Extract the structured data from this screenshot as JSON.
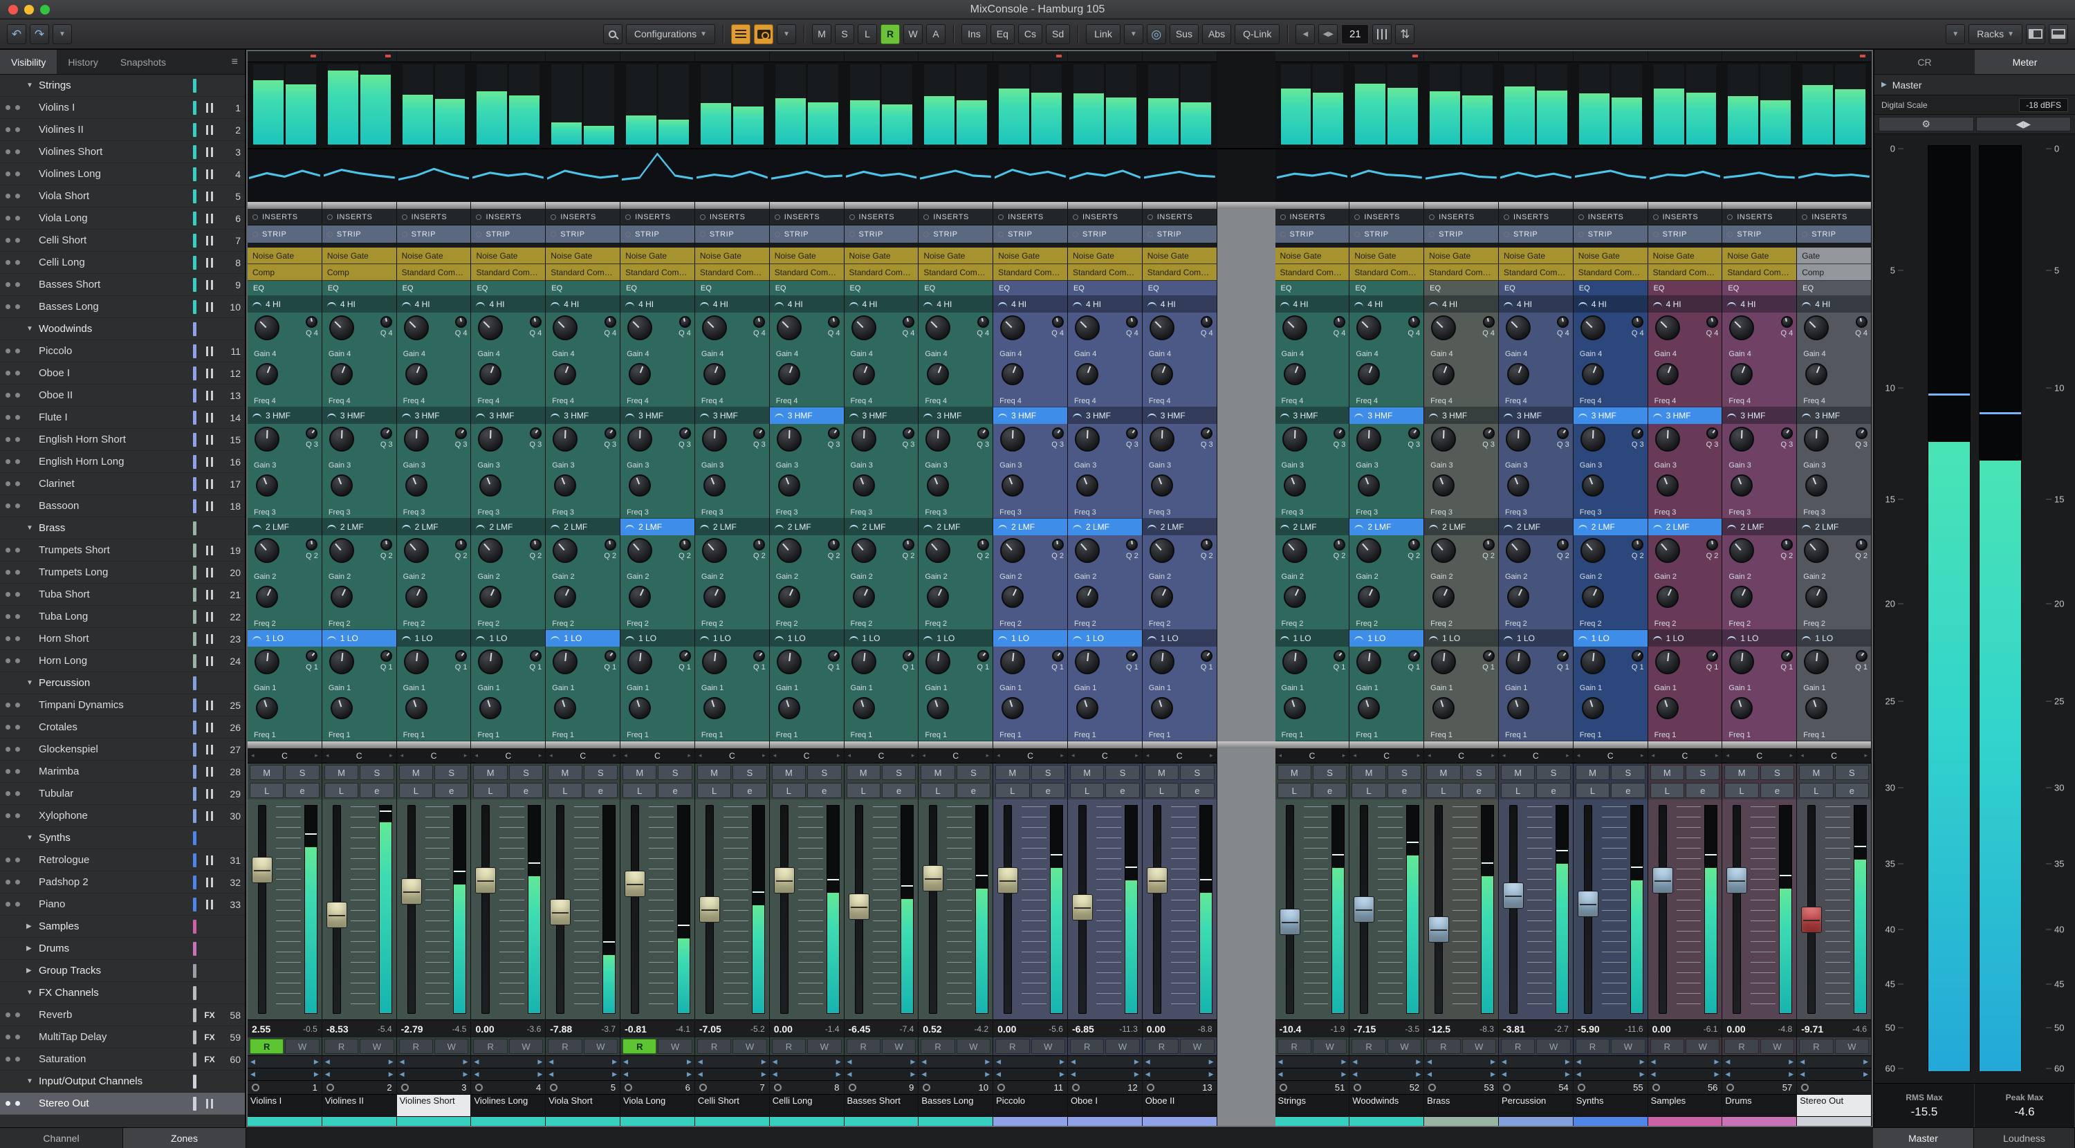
{
  "window": {
    "title": "MixConsole - Hamburg 105"
  },
  "icons": {
    "undo": "↶",
    "redo": "↷",
    "dropdown": "▼",
    "collapsed": "▶",
    "expanded": "▼",
    "hamburger": "≡",
    "gear": "⚙",
    "link_sync": "◎",
    "nav_left": "◀",
    "nav_right": "▶",
    "nav_pair": "◀▶",
    "updown": "⇅",
    "master_arrow": "▶"
  },
  "toolbar": {
    "configurations": "Configurations",
    "m": "M",
    "s": "S",
    "l": "L",
    "r": "R",
    "w": "W",
    "a": "A",
    "ins": "Ins",
    "eq": "Eq",
    "cs": "Cs",
    "sd": "Sd",
    "link": "Link",
    "sus": "Sus",
    "abs": "Abs",
    "qlink": "Q-Link",
    "counter": "21",
    "racks": "Racks"
  },
  "sidebar": {
    "tabs": [
      "Visibility",
      "History",
      "Snapshots"
    ],
    "rows": [
      {
        "type": "folder",
        "label": "Strings",
        "expanded": true,
        "color": "#36cfc0"
      },
      {
        "type": "ch",
        "label": "Violins I",
        "num": "1",
        "color": "#36cfc0"
      },
      {
        "type": "ch",
        "label": "Violines II",
        "num": "2",
        "color": "#36cfc0"
      },
      {
        "type": "ch",
        "label": "Violines Short",
        "num": "3",
        "color": "#36cfc0"
      },
      {
        "type": "ch",
        "label": "Violines Long",
        "num": "4",
        "color": "#36cfc0"
      },
      {
        "type": "ch",
        "label": "Viola Short",
        "num": "5",
        "color": "#36cfc0"
      },
      {
        "type": "ch",
        "label": "Viola Long",
        "num": "6",
        "color": "#36cfc0"
      },
      {
        "type": "ch",
        "label": "Celli Short",
        "num": "7",
        "color": "#36cfc0"
      },
      {
        "type": "ch",
        "label": "Celli Long",
        "num": "8",
        "color": "#36cfc0"
      },
      {
        "type": "ch",
        "label": "Basses Short",
        "num": "9",
        "color": "#36cfc0"
      },
      {
        "type": "ch",
        "label": "Basses Long",
        "num": "10",
        "color": "#36cfc0"
      },
      {
        "type": "folder",
        "label": "Woodwinds",
        "expanded": true,
        "color": "#8fa2e8"
      },
      {
        "type": "ch",
        "label": "Piccolo",
        "num": "11",
        "color": "#8fa2e8"
      },
      {
        "type": "ch",
        "label": "Oboe I",
        "num": "12",
        "color": "#8fa2e8"
      },
      {
        "type": "ch",
        "label": "Oboe II",
        "num": "13",
        "color": "#8fa2e8"
      },
      {
        "type": "ch",
        "label": "Flute I",
        "num": "14",
        "color": "#8fa2e8"
      },
      {
        "type": "ch",
        "label": "English Horn Short",
        "num": "15",
        "color": "#8fa2e8"
      },
      {
        "type": "ch",
        "label": "English Horn Long",
        "num": "16",
        "color": "#8fa2e8"
      },
      {
        "type": "ch",
        "label": "Clarinet",
        "num": "17",
        "color": "#8fa2e8"
      },
      {
        "type": "ch",
        "label": "Bassoon",
        "num": "18",
        "color": "#8fa2e8"
      },
      {
        "type": "folder",
        "label": "Brass",
        "expanded": true,
        "color": "#9ab4a4"
      },
      {
        "type": "ch",
        "label": "Trumpets Short",
        "num": "19",
        "color": "#9ab4a4"
      },
      {
        "type": "ch",
        "label": "Trumpets Long",
        "num": "20",
        "color": "#9ab4a4"
      },
      {
        "type": "ch",
        "label": "Tuba Short",
        "num": "21",
        "color": "#9ab4a4"
      },
      {
        "type": "ch",
        "label": "Tuba Long",
        "num": "22",
        "color": "#9ab4a4"
      },
      {
        "type": "ch",
        "label": "Horn Short",
        "num": "23",
        "color": "#9ab4a4"
      },
      {
        "type": "ch",
        "label": "Horn Long",
        "num": "24",
        "color": "#9ab4a4"
      },
      {
        "type": "folder",
        "label": "Percussion",
        "expanded": true,
        "color": "#82a0dc"
      },
      {
        "type": "ch",
        "label": "Timpani Dynamics",
        "num": "25",
        "color": "#82a0dc"
      },
      {
        "type": "ch",
        "label": "Crotales",
        "num": "26",
        "color": "#82a0dc"
      },
      {
        "type": "ch",
        "label": "Glockenspiel",
        "num": "27",
        "color": "#82a0dc"
      },
      {
        "type": "ch",
        "label": "Marimba",
        "num": "28",
        "color": "#82a0dc"
      },
      {
        "type": "ch",
        "label": "Tubular",
        "num": "29",
        "color": "#82a0dc"
      },
      {
        "type": "ch",
        "label": "Xylophone",
        "num": "30",
        "color": "#82a0dc"
      },
      {
        "type": "folder",
        "label": "Synths",
        "expanded": true,
        "color": "#4f86e8"
      },
      {
        "type": "ch",
        "label": "Retrologue",
        "num": "31",
        "color": "#4f86e8"
      },
      {
        "type": "ch",
        "label": "Padshop 2",
        "num": "32",
        "color": "#4f86e8"
      },
      {
        "type": "ch",
        "label": "Piano",
        "num": "33",
        "color": "#4f86e8"
      },
      {
        "type": "folder",
        "label": "Samples",
        "expanded": false,
        "color": "#cc62a6"
      },
      {
        "type": "folder",
        "label": "Drums",
        "expanded": false,
        "color": "#c873b8"
      },
      {
        "type": "folder",
        "label": "Group Tracks",
        "expanded": false,
        "color": "#9aa0a8"
      },
      {
        "type": "folder",
        "label": "FX Channels",
        "expanded": true,
        "color": "#b8bcc0"
      },
      {
        "type": "ch",
        "label": "Reverb",
        "num": "58",
        "badge": "fx",
        "color": "#b8bcc0"
      },
      {
        "type": "ch",
        "label": "MultiTap Delay",
        "num": "59",
        "badge": "fx",
        "color": "#b8bcc0"
      },
      {
        "type": "ch",
        "label": "Saturation",
        "num": "60",
        "badge": "fx",
        "color": "#b8bcc0"
      },
      {
        "type": "folder",
        "label": "Input/Output Channels",
        "expanded": true,
        "color": "#cdd2d8"
      },
      {
        "type": "ch",
        "label": "Stereo Out",
        "num": "",
        "selected": true,
        "color": "#cdd2d8"
      }
    ]
  },
  "mixer": {
    "labels": {
      "inserts": "INSERTS",
      "strip": "STRIP",
      "eq": "EQ",
      "mute": "M",
      "solo": "S",
      "listen": "L",
      "edit": "e",
      "read": "R",
      "write": "W",
      "pan_center": "C"
    },
    "eq_bands": [
      {
        "label": "4 HI",
        "gain": "Gain 4",
        "freq": "Freq 4",
        "q": "Q 4"
      },
      {
        "label": "3 HMF",
        "gain": "Gain 3",
        "freq": "Freq 3",
        "q": "Q 3"
      },
      {
        "label": "2 LMF",
        "gain": "Gain 2",
        "freq": "Freq 2",
        "q": "Q 2"
      },
      {
        "label": "1 LO",
        "gain": "Gain 1",
        "freq": "Freq 1",
        "q": "Q 1"
      }
    ],
    "groups": {
      "strings": {
        "rack": "#2f695e",
        "fader": "#41524d",
        "strip": "#36cfc0",
        "cap": "#e9e5b2"
      },
      "woodwinds": {
        "rack": "#4c5885",
        "fader": "#474e66",
        "strip": "#8fa2e8",
        "cap": "#e9e5b2"
      },
      "bus_teal": {
        "rack": "#2f695e",
        "fader": "#41524d",
        "strip": "#36cfc0",
        "cap": "#a9cdea"
      },
      "bus_brass": {
        "rack": "#555c58",
        "fader": "#4a4f4c",
        "strip": "#9ab4a4",
        "cap": "#a9cdea"
      },
      "bus_perc": {
        "rack": "#46547c",
        "fader": "#444b60",
        "strip": "#82a0dc",
        "cap": "#a9cdea"
      },
      "bus_synth": {
        "rack": "#2c477c",
        "fader": "#3c465e",
        "strip": "#4f86e8",
        "cap": "#a9cdea"
      },
      "bus_samples": {
        "rack": "#693a58",
        "fader": "#54424e",
        "strip": "#cc62a6",
        "cap": "#a9cdea"
      },
      "bus_drums": {
        "rack": "#6e4165",
        "fader": "#564452",
        "strip": "#c873b8",
        "cap": "#a9cdea"
      },
      "out": {
        "rack": "#54585e",
        "fader": "#4a4e54",
        "strip": "#cdd2d8",
        "cap": "#d84848"
      }
    },
    "channels": [
      {
        "name": "Violins I",
        "num": "1",
        "group": "strings",
        "db": "2.55",
        "peak": "-0.5",
        "meter": 0.8,
        "fader": 0.715,
        "gate": "Noise Gate",
        "comp": "Comp",
        "r": true,
        "clip": true,
        "ab": [
          3
        ],
        "curve": [
          0.45,
          0.55,
          0.48,
          0.6,
          0.5
        ]
      },
      {
        "name": "Violines II",
        "num": "2",
        "group": "strings",
        "db": "-8.53",
        "peak": "-5.4",
        "meter": 0.92,
        "fader": 0.47,
        "gate": "Noise Gate",
        "comp": "Comp",
        "clip": true,
        "ab": [
          3
        ],
        "curve": [
          0.5,
          0.62,
          0.55,
          0.5,
          0.46
        ]
      },
      {
        "name": "Violines Short",
        "num": "3",
        "group": "strings",
        "db": "-2.79",
        "peak": "-4.5",
        "meter": 0.62,
        "fader": 0.6,
        "gate": "Noise Gate",
        "comp": "Standard Com…",
        "sel": true,
        "ab": [],
        "curve": [
          0.42,
          0.5,
          0.64,
          0.52,
          0.44
        ]
      },
      {
        "name": "Violines Long",
        "num": "4",
        "group": "strings",
        "db": "0.00",
        "peak": "-3.6",
        "meter": 0.66,
        "fader": 0.66,
        "gate": "Noise Gate",
        "comp": "Standard Com…",
        "ab": [],
        "curve": [
          0.46,
          0.56,
          0.5,
          0.54,
          0.46
        ]
      },
      {
        "name": "Viola Short",
        "num": "5",
        "group": "strings",
        "db": "-7.88",
        "peak": "-3.7",
        "meter": 0.28,
        "fader": 0.485,
        "gate": "Noise Gate",
        "comp": "Standard Com…",
        "ab": [
          3
        ],
        "curve": [
          0.44,
          0.6,
          0.52,
          0.46,
          0.5
        ]
      },
      {
        "name": "Viola Long",
        "num": "6",
        "group": "strings",
        "db": "-0.81",
        "peak": "-4.1",
        "meter": 0.36,
        "fader": 0.64,
        "gate": "Noise Gate",
        "comp": "Standard Com…",
        "r": true,
        "ab": [
          2
        ],
        "curve": [
          0.42,
          0.46,
          0.95,
          0.5,
          0.44
        ]
      },
      {
        "name": "Celli Short",
        "num": "7",
        "group": "strings",
        "db": "-7.05",
        "peak": "-5.2",
        "meter": 0.52,
        "fader": 0.5,
        "gate": "Noise Gate",
        "comp": "Standard Com…",
        "ab": [],
        "curve": [
          0.46,
          0.52,
          0.48,
          0.58,
          0.46
        ]
      },
      {
        "name": "Celli Long",
        "num": "8",
        "group": "strings",
        "db": "0.00",
        "peak": "-1.4",
        "meter": 0.58,
        "fader": 0.66,
        "gate": "Noise Gate",
        "comp": "Standard Com…",
        "ab": [
          1
        ],
        "curve": [
          0.44,
          0.5,
          0.58,
          0.48,
          0.5
        ]
      },
      {
        "name": "Basses Short",
        "num": "9",
        "group": "strings",
        "db": "-6.45",
        "peak": "-7.4",
        "meter": 0.55,
        "fader": 0.515,
        "gate": "Noise Gate",
        "comp": "Standard Com…",
        "ab": [],
        "curve": [
          0.48,
          0.58,
          0.5,
          0.54,
          0.46
        ]
      },
      {
        "name": "Basses Long",
        "num": "10",
        "group": "strings",
        "db": "0.52",
        "peak": "-4.2",
        "meter": 0.6,
        "fader": 0.67,
        "gate": "Noise Gate",
        "comp": "Standard Com…",
        "ab": [],
        "curve": [
          0.44,
          0.52,
          0.6,
          0.5,
          0.48
        ]
      },
      {
        "name": "Piccolo",
        "num": "11",
        "group": "woodwinds",
        "db": "0.00",
        "peak": "-5.6",
        "meter": 0.7,
        "fader": 0.66,
        "gate": "Noise Gate",
        "comp": "Standard Com…",
        "clip": true,
        "ab": [
          1,
          2,
          3
        ],
        "curve": [
          0.46,
          0.62,
          0.52,
          0.58,
          0.48
        ]
      },
      {
        "name": "Oboe I",
        "num": "12",
        "group": "woodwinds",
        "db": "-6.85",
        "peak": "-11.3",
        "meter": 0.64,
        "fader": 0.51,
        "gate": "Noise Gate",
        "comp": "Standard Com…",
        "ab": [
          2,
          3
        ],
        "curve": [
          0.44,
          0.55,
          0.5,
          0.6,
          0.46
        ]
      },
      {
        "name": "Oboe II",
        "num": "13",
        "group": "woodwinds",
        "db": "0.00",
        "peak": "-8.8",
        "meter": 0.58,
        "fader": 0.66,
        "gate": "Noise Gate",
        "comp": "Standard Com…",
        "ab": [],
        "curve": [
          0.46,
          0.52,
          0.58,
          0.5,
          0.48
        ]
      },
      {
        "name": "Strings",
        "num": "51",
        "group": "bus_teal",
        "db": "-10.4",
        "peak": "-1.9",
        "meter": 0.7,
        "fader": 0.43,
        "gate": "Noise Gate",
        "comp": "Standard Com…",
        "ab": [],
        "curve": [
          0.46,
          0.54,
          0.5,
          0.56,
          0.48
        ]
      },
      {
        "name": "Woodwinds",
        "num": "52",
        "group": "bus_teal",
        "db": "-7.15",
        "peak": "-3.5",
        "meter": 0.76,
        "fader": 0.5,
        "gate": "Noise Gate",
        "comp": "Standard Com…",
        "clip": true,
        "ab": [
          1,
          2,
          3
        ],
        "curve": [
          0.48,
          0.6,
          0.52,
          0.5,
          0.46
        ]
      },
      {
        "name": "Brass",
        "num": "53",
        "group": "bus_brass",
        "db": "-12.5",
        "peak": "-8.3",
        "meter": 0.66,
        "fader": 0.39,
        "gate": "Noise Gate",
        "comp": "Standard Com…",
        "ab": [],
        "curve": [
          0.44,
          0.5,
          0.55,
          0.48,
          0.46
        ]
      },
      {
        "name": "Percussion",
        "num": "54",
        "group": "bus_perc",
        "db": "-3.81",
        "peak": "-2.7",
        "meter": 0.72,
        "fader": 0.575,
        "gate": "Noise Gate",
        "comp": "Standard Com…",
        "ab": [],
        "curve": [
          0.46,
          0.56,
          0.48,
          0.54,
          0.46
        ]
      },
      {
        "name": "Synths",
        "num": "55",
        "group": "bus_synth",
        "db": "-5.90",
        "peak": "-11.6",
        "meter": 0.64,
        "fader": 0.53,
        "gate": "Noise Gate",
        "comp": "Standard Com…",
        "ab": [
          1,
          2,
          3
        ],
        "curve": [
          0.48,
          0.54,
          0.6,
          0.5,
          0.46
        ]
      },
      {
        "name": "Samples",
        "num": "56",
        "group": "bus_samples",
        "db": "0.00",
        "peak": "-6.1",
        "meter": 0.7,
        "fader": 0.66,
        "gate": "Noise Gate",
        "comp": "Standard Com…",
        "ab": [
          1,
          2
        ],
        "curve": [
          0.44,
          0.52,
          0.5,
          0.58,
          0.48
        ]
      },
      {
        "name": "Drums",
        "num": "57",
        "group": "bus_drums",
        "db": "0.00",
        "peak": "-4.8",
        "meter": 0.6,
        "fader": 0.66,
        "gate": "Noise Gate",
        "comp": "Standard Com…",
        "ab": [],
        "curve": [
          0.46,
          0.5,
          0.56,
          0.48,
          0.46
        ]
      },
      {
        "name": "Stereo Out",
        "num": "",
        "group": "out",
        "db": "-9.71",
        "peak": "-4.6",
        "meter": 0.74,
        "fader": 0.445,
        "gate": "Gate",
        "comp": "Comp",
        "sel": true,
        "clip": true,
        "gray_slots": true,
        "ab": [],
        "curve": [
          0.46,
          0.54,
          0.5,
          0.52,
          0.48
        ]
      }
    ],
    "left_group_count": 13
  },
  "meter_panel": {
    "tabs": [
      "CR",
      "Meter"
    ],
    "master_label": "Master",
    "digital_scale_label": "Digital Scale",
    "digital_scale_value": "-18 dBFS",
    "scale_ticks": [
      {
        "label": "0",
        "pos": 0.004
      },
      {
        "label": "5",
        "pos": 0.135
      },
      {
        "label": "10",
        "pos": 0.262
      },
      {
        "label": "15",
        "pos": 0.382
      },
      {
        "label": "20",
        "pos": 0.495
      },
      {
        "label": "25",
        "pos": 0.6
      },
      {
        "label": "30",
        "pos": 0.693
      },
      {
        "label": "35",
        "pos": 0.775
      },
      {
        "label": "40",
        "pos": 0.846
      },
      {
        "label": "45",
        "pos": 0.905
      },
      {
        "label": "50",
        "pos": 0.952
      },
      {
        "label": "60",
        "pos": 0.996
      }
    ],
    "levels": {
      "l": 0.68,
      "r": 0.66,
      "peak_l": 0.73,
      "peak_r": 0.71
    },
    "rms_max_label": "RMS Max",
    "rms_max_value": "-15.5",
    "peak_max_label": "Peak Max",
    "peak_max_value": "-4.6"
  },
  "bottom": {
    "left_tabs": [
      "Channel",
      "Zones"
    ],
    "right_tabs": [
      "Master",
      "Loudness"
    ]
  }
}
